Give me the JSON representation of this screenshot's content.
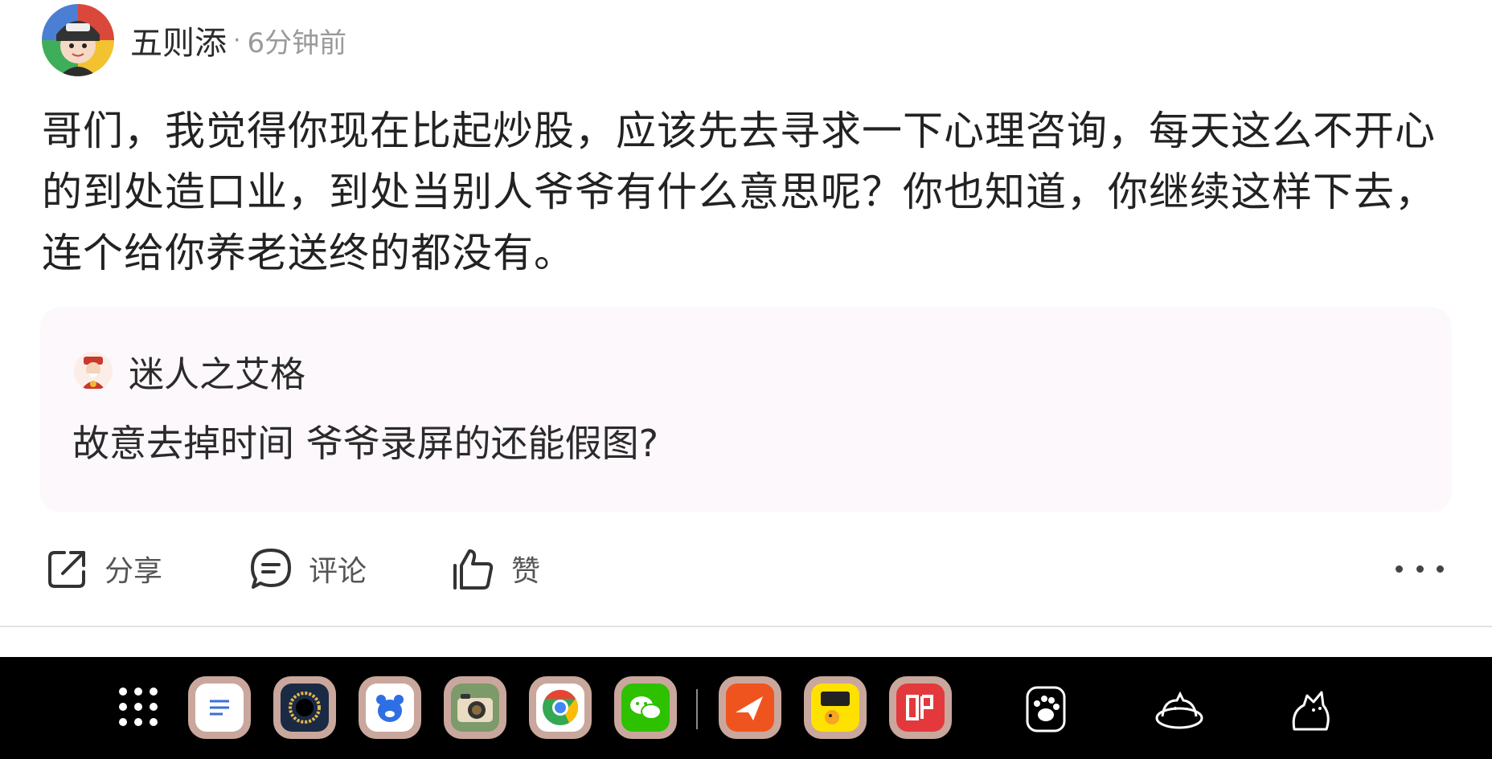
{
  "post": {
    "author": "五则添",
    "meta_separator": "·",
    "time_ago": "6分钟前",
    "body": "哥们，我觉得你现在比起炒股，应该先去寻求一下心理咨询，每天这么不开心的到处造口业，到处当别人爷爷有什么意思呢？你也知道，你继续这样下去，连个给你养老送终的都没有。"
  },
  "quote": {
    "author": "迷人之艾格",
    "text": "故意去掉时间 爷爷录屏的还能假图?"
  },
  "actions": {
    "share": "分享",
    "comment": "评论",
    "like": "赞"
  },
  "taskbar": {
    "apps": [
      "notes",
      "camera-lens",
      "baidu-netdisk",
      "retro-camera",
      "chrome",
      "wechat",
      "feishu",
      "xianyu",
      "jd"
    ],
    "pets": [
      "paw",
      "cat-in-bowl",
      "cat"
    ]
  },
  "colors": {
    "quote_bg": "#fcf8fb",
    "taskbar_bg": "#000000",
    "muted_text": "#9a9a9a"
  }
}
